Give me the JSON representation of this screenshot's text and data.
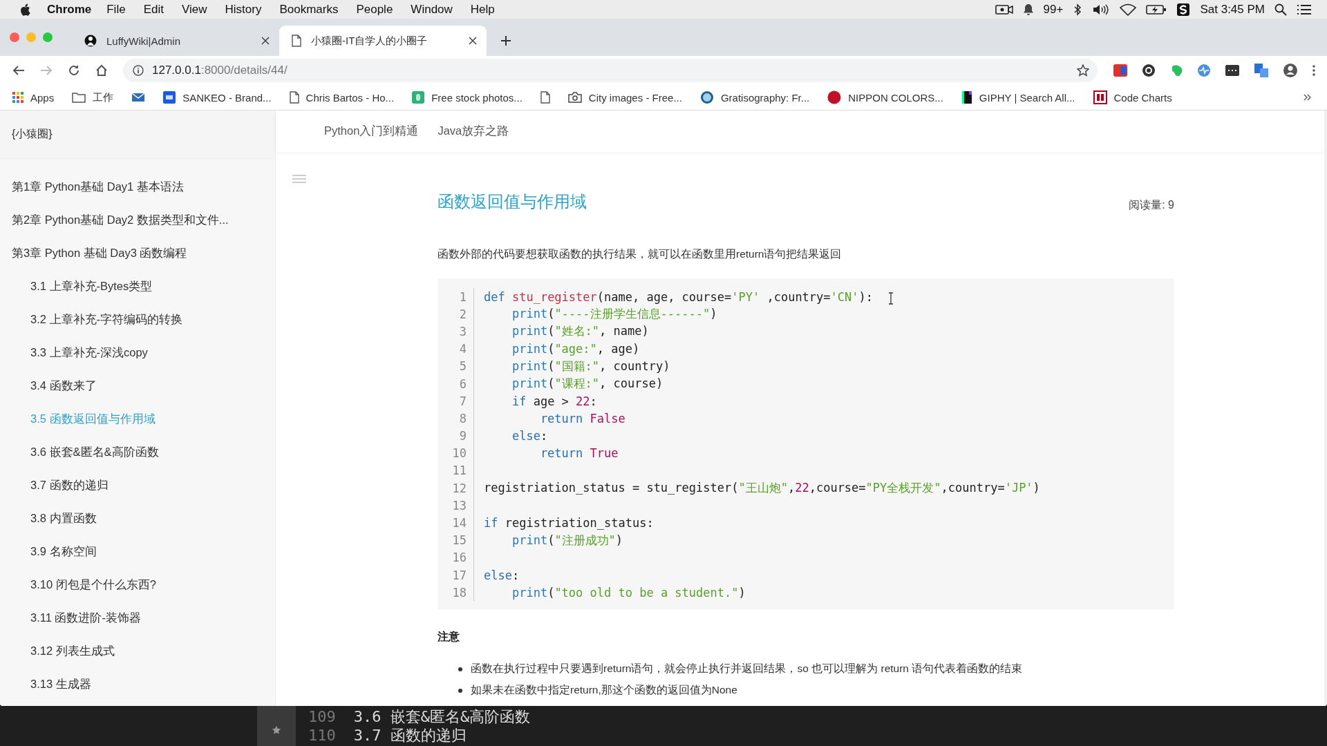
{
  "menu_bar": {
    "app": "Chrome",
    "items": [
      "File",
      "Edit",
      "View",
      "History",
      "Bookmarks",
      "People",
      "Window",
      "Help"
    ],
    "notifications": "99+",
    "clock": "Sat 3:45 PM"
  },
  "tabs": [
    {
      "title": "LuffyWiki|Admin",
      "selected": false
    },
    {
      "title": "小猿圈-IT自学人的小圈子",
      "selected": true
    }
  ],
  "address_bar": {
    "host": "127.0.0.1",
    "path": ":8000/details/44/"
  },
  "bookmarks": [
    {
      "kind": "labeled",
      "label": "Apps"
    },
    {
      "kind": "labeled",
      "label": "工作"
    },
    {
      "kind": "icon_only"
    },
    {
      "kind": "labeled",
      "label": "SANKEO - Brand..."
    },
    {
      "kind": "labeled",
      "label": "Chris Bartos - Ho..."
    },
    {
      "kind": "labeled",
      "label": "Free stock photos..."
    },
    {
      "kind": "icon_only"
    },
    {
      "kind": "labeled",
      "label": "City images - Free..."
    },
    {
      "kind": "labeled",
      "label": "Gratisography: Fr..."
    },
    {
      "kind": "labeled",
      "label": "NIPPON COLORS..."
    },
    {
      "kind": "labeled",
      "label": "GIPHY | Search All..."
    },
    {
      "kind": "labeled",
      "label": "Code Charts"
    }
  ],
  "sidebar": {
    "brand": "{小猿圈}",
    "items": [
      {
        "label": "第1章 Python基础 Day1 基本语法",
        "selected": false
      },
      {
        "label": "第2章 Python基础 Day2 数据类型和文件...",
        "selected": false
      },
      {
        "label": "第3章 Python 基础 Day3 函数编程",
        "selected": false,
        "children": [
          {
            "label": "3.1 上章补充-Bytes类型",
            "selected": false
          },
          {
            "label": "3.2 上章补充-字符编码的转换",
            "selected": false
          },
          {
            "label": "3.3 上章补充-深浅copy",
            "selected": false
          },
          {
            "label": "3.4 函数来了",
            "selected": false
          },
          {
            "label": "3.5 函数返回值与作用域",
            "selected": true
          },
          {
            "label": "3.6 嵌套&匿名&高阶函数",
            "selected": false
          },
          {
            "label": "3.7 函数的递归",
            "selected": false
          },
          {
            "label": "3.8 内置函数",
            "selected": false
          },
          {
            "label": "3.9 名称空间",
            "selected": false
          },
          {
            "label": "3.10 闭包是个什么东西?",
            "selected": false
          },
          {
            "label": "3.11 函数进阶-装饰器",
            "selected": false
          },
          {
            "label": "3.12 列表生成式",
            "selected": false
          },
          {
            "label": "3.13 生成器",
            "selected": false
          }
        ]
      }
    ]
  },
  "top_nav": [
    "Python入门到精通",
    "Java放弃之路"
  ],
  "article": {
    "title": "函数返回值与作用域",
    "views": "阅读量: 9",
    "intro": "函数外部的代码要想获取函数的执行结果，就可以在函数里用return语句把结果返回",
    "code": [
      {
        "number": "1",
        "tokens": [
          {
            "kind": "kw",
            "text": "def"
          },
          {
            "kind": "fn",
            "text": " stu_register"
          },
          {
            "kind": "plain",
            "text": "(name, age, course="
          },
          {
            "kind": "str",
            "text": "'PY'"
          },
          {
            "kind": "plain",
            "text": " ,country="
          },
          {
            "kind": "str",
            "text": "'CN'"
          },
          {
            "kind": "plain",
            "text": "):"
          }
        ]
      },
      {
        "number": "2",
        "tokens": [
          {
            "kind": "call",
            "text": "    print"
          },
          {
            "kind": "plain",
            "text": "("
          },
          {
            "kind": "str",
            "text": "\"----注册学生信息------\""
          },
          {
            "kind": "plain",
            "text": ")"
          }
        ]
      },
      {
        "number": "3",
        "tokens": [
          {
            "kind": "call",
            "text": "    print"
          },
          {
            "kind": "plain",
            "text": "("
          },
          {
            "kind": "str",
            "text": "\"姓名:\""
          },
          {
            "kind": "plain",
            "text": ", name)"
          }
        ]
      },
      {
        "number": "4",
        "tokens": [
          {
            "kind": "call",
            "text": "    print"
          },
          {
            "kind": "plain",
            "text": "("
          },
          {
            "kind": "str",
            "text": "\"age:\""
          },
          {
            "kind": "plain",
            "text": ", age)"
          }
        ]
      },
      {
        "number": "5",
        "tokens": [
          {
            "kind": "call",
            "text": "    print"
          },
          {
            "kind": "plain",
            "text": "("
          },
          {
            "kind": "str",
            "text": "\"国籍:\""
          },
          {
            "kind": "plain",
            "text": ", country)"
          }
        ]
      },
      {
        "number": "6",
        "tokens": [
          {
            "kind": "call",
            "text": "    print"
          },
          {
            "kind": "plain",
            "text": "("
          },
          {
            "kind": "str",
            "text": "\"课程:\""
          },
          {
            "kind": "plain",
            "text": ", course)"
          }
        ]
      },
      {
        "number": "7",
        "tokens": [
          {
            "kind": "kw",
            "text": "    if"
          },
          {
            "kind": "plain",
            "text": " age > "
          },
          {
            "kind": "num",
            "text": "22"
          },
          {
            "kind": "plain",
            "text": ":"
          }
        ]
      },
      {
        "number": "8",
        "tokens": [
          {
            "kind": "kw",
            "text": "        return"
          },
          {
            "kind": "num",
            "text": " False"
          }
        ]
      },
      {
        "number": "9",
        "tokens": [
          {
            "kind": "kw",
            "text": "    else"
          },
          {
            "kind": "plain",
            "text": ":"
          }
        ]
      },
      {
        "number": "10",
        "tokens": [
          {
            "kind": "kw",
            "text": "        return"
          },
          {
            "kind": "num",
            "text": " True"
          }
        ]
      },
      {
        "number": "11"
      },
      {
        "number": "12",
        "tokens": [
          {
            "kind": "plain",
            "text": "registriation_status = stu_register("
          },
          {
            "kind": "str",
            "text": "\"王山炮\""
          },
          {
            "kind": "plain",
            "text": ","
          },
          {
            "kind": "num",
            "text": "22"
          },
          {
            "kind": "plain",
            "text": ",course="
          },
          {
            "kind": "str",
            "text": "\"PY全栈开发\""
          },
          {
            "kind": "plain",
            "text": ",country="
          },
          {
            "kind": "str",
            "text": "'JP'"
          },
          {
            "kind": "plain",
            "text": ")"
          }
        ]
      },
      {
        "number": "13"
      },
      {
        "number": "14",
        "tokens": [
          {
            "kind": "kw",
            "text": "if"
          },
          {
            "kind": "plain",
            "text": " registriation_status:"
          }
        ]
      },
      {
        "number": "15",
        "tokens": [
          {
            "kind": "call",
            "text": "    print"
          },
          {
            "kind": "plain",
            "text": "("
          },
          {
            "kind": "str",
            "text": "\"注册成功\""
          },
          {
            "kind": "plain",
            "text": ")"
          }
        ]
      },
      {
        "number": "16"
      },
      {
        "number": "17",
        "tokens": [
          {
            "kind": "kw",
            "text": "else"
          },
          {
            "kind": "plain",
            "text": ":"
          }
        ]
      },
      {
        "number": "18",
        "tokens": [
          {
            "kind": "call",
            "text": "    print"
          },
          {
            "kind": "plain",
            "text": "("
          },
          {
            "kind": "str",
            "text": "\"too old to be a student.\""
          },
          {
            "kind": "plain",
            "text": ")"
          }
        ]
      }
    ],
    "note_heading": "注意",
    "notes": [
      "函数在执行过程中只要遇到return语句，就会停止执行并返回结果，so 也可以理解为 return 语句代表着函数的结束",
      "如果未在函数中指定return,那这个函数的返回值为None"
    ]
  },
  "editor_behind": [
    {
      "number": "109",
      "text": "3.6 嵌套&匿名&高阶函数"
    },
    {
      "number": "110",
      "text": "3.7 函数的递归"
    }
  ]
}
